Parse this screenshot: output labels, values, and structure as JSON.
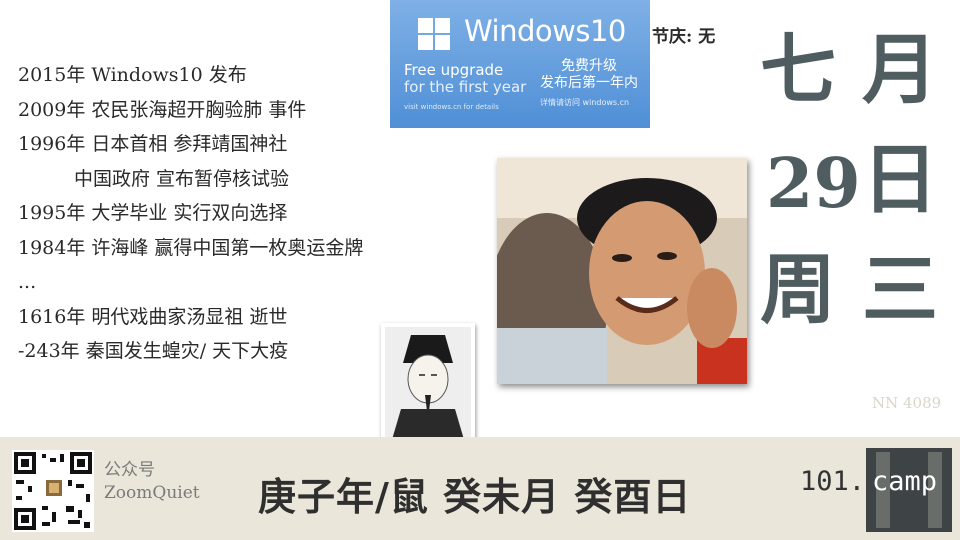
{
  "events": [
    {
      "text": "2015年 Windows10 发布"
    },
    {
      "text": "2009年 农民张海超开胸验肺 事件"
    },
    {
      "text": "1996年 日本首相 参拜靖国神社"
    },
    {
      "text": "中国政府 宣布暂停核试验",
      "indent": true
    },
    {
      "text": "1995年 大学毕业 实行双向选择"
    },
    {
      "text": "1984年 许海峰 赢得中国第一枚奥运金牌"
    },
    {
      "text": "..."
    },
    {
      "text": "1616年 明代戏曲家汤显祖 逝世"
    },
    {
      "text": "-243年 秦国发生蝗灾/ 天下大疫"
    }
  ],
  "windows_banner": {
    "title": "Windows10",
    "free_upgrade": "Free upgrade",
    "first_year": "for the first year",
    "visit_text": "visit windows.cn for details",
    "cn_line1": "免费升级",
    "cn_line2": "发布后第一年内",
    "cn_small": "详情请访问 windows.cn"
  },
  "festival": "节庆:  无",
  "calendar": {
    "month_num": "七",
    "month_label": "月",
    "day_num": "29",
    "day_label": "日",
    "week_label": "周",
    "weekday": "三"
  },
  "watermark": "NN 4089",
  "footer": {
    "account_label": "公众号",
    "account_name": "ZoomQuiet",
    "ganzhi": "庚子年/鼠  癸未月  癸酉日",
    "camp_num": "101.",
    "camp_text": "camp"
  },
  "colors": {
    "big_text": "#4f5d61",
    "footer_bg": "#eae6d9",
    "banner_blue": "#4f8fd6",
    "logo_bg": "#3e4446"
  }
}
